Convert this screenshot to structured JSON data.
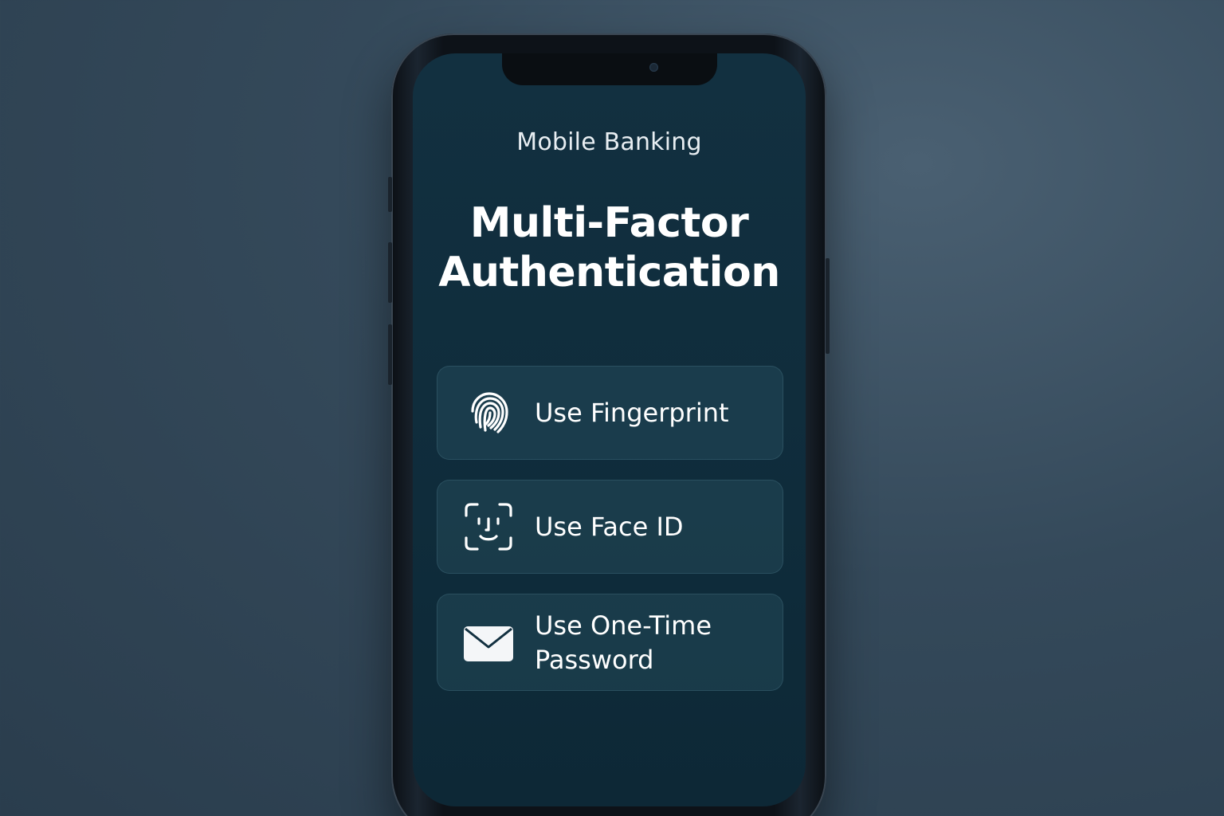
{
  "app": {
    "name": "Mobile Banking"
  },
  "screen": {
    "title": "Multi-Factor Authentication"
  },
  "options": [
    {
      "label": "Use Fingerprint",
      "icon": "fingerprint-icon"
    },
    {
      "label": "Use Face ID",
      "icon": "face-id-icon"
    },
    {
      "label": "Use One-Time Password",
      "icon": "envelope-icon"
    }
  ],
  "colors": {
    "background": "#34495a",
    "screen": "#123040",
    "card": "#1f4656",
    "text": "#ffffff"
  }
}
